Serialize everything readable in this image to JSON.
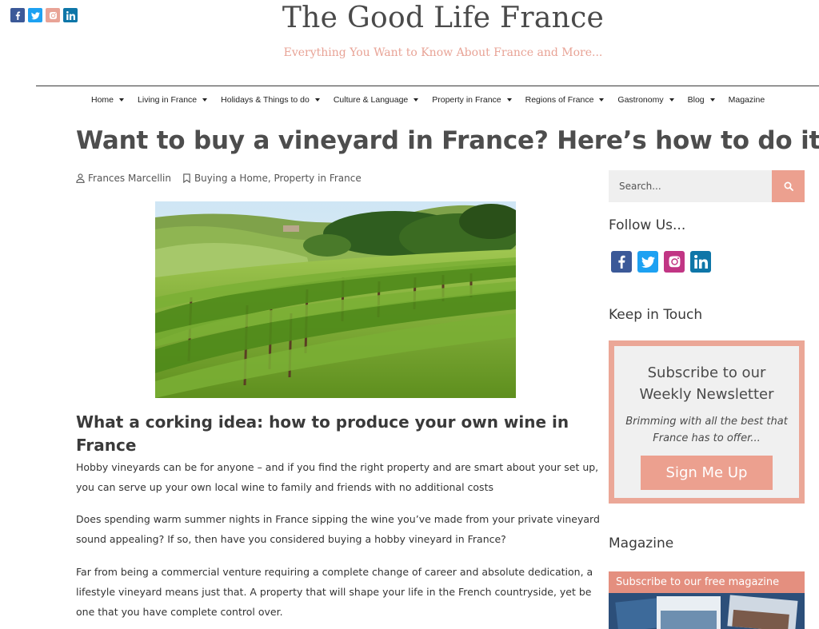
{
  "social_top": [
    {
      "name": "facebook-icon",
      "color": "#3b5998"
    },
    {
      "name": "twitter-icon",
      "color": "#1da1f2"
    },
    {
      "name": "instagram-icon",
      "color": "#e8a396"
    },
    {
      "name": "linkedin-icon",
      "color": "#0e76a8"
    }
  ],
  "header": {
    "title": "The Good Life France",
    "tagline": "Everything You Want to Know About France and More..."
  },
  "nav": [
    {
      "label": "Home",
      "has_dropdown": true
    },
    {
      "label": "Living in France",
      "has_dropdown": true
    },
    {
      "label": "Holidays & Things to do",
      "has_dropdown": true
    },
    {
      "label": "Culture & Language",
      "has_dropdown": true
    },
    {
      "label": "Property in France",
      "has_dropdown": true
    },
    {
      "label": "Regions of France",
      "has_dropdown": true
    },
    {
      "label": "Gastronomy",
      "has_dropdown": true
    },
    {
      "label": "Blog",
      "has_dropdown": true
    },
    {
      "label": "Magazine",
      "has_dropdown": false
    }
  ],
  "article": {
    "title": "Want to buy a vineyard in France? Here’s how to do it",
    "author": "Frances Marcellin",
    "category_1": "Buying a Home",
    "category_sep": ", ",
    "category_2": "Property in France",
    "subheading": "What a corking idea: how to produce your own wine in France",
    "paragraphs": [
      "Hobby vineyards can be for anyone – and if you find the right property and are smart about your set up, you can serve up your own local wine to family and friends with no additional costs",
      "Does spending warm summer nights in France sipping the wine you’ve made from your private vineyard sound appealing? If so, then have you considered buying a hobby vineyard in France?",
      "Far from being a commercial venture requiring a complete change of career and absolute dedication, a lifestyle vineyard means just that. A property that will shape your life in the French countryside, yet be one that you have complete control over."
    ]
  },
  "sidebar": {
    "search_placeholder": "Search...",
    "follow_heading": "Follow Us...",
    "follow_icons": [
      {
        "name": "facebook-icon",
        "color": "#3b5998"
      },
      {
        "name": "twitter-icon",
        "color": "#1da1f2"
      },
      {
        "name": "instagram-icon",
        "color": "#c13584"
      },
      {
        "name": "linkedin-icon",
        "color": "#0e76a8"
      }
    ],
    "touch_heading": "Keep in Touch",
    "newsletter_title": "Subscribe to our Weekly Newsletter",
    "newsletter_sub": "Brimming with all the best that France has to offer...",
    "newsletter_button": "Sign Me Up",
    "magazine_heading": "Magazine",
    "magazine_banner": "Subscribe to our free magazine"
  },
  "colors": {
    "accent": "#eca08f",
    "tagline": "#e8a396"
  }
}
